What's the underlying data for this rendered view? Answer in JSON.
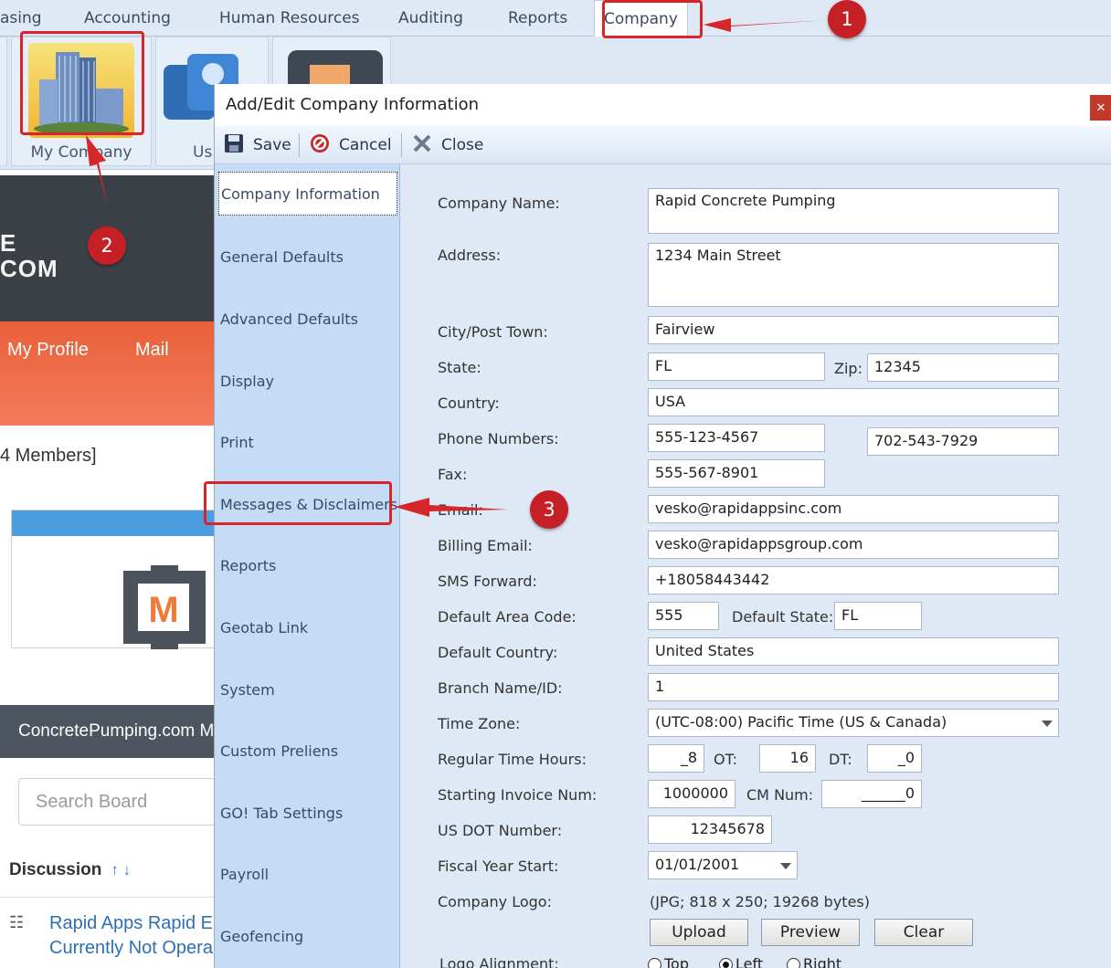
{
  "ribbon": {
    "tabs": [
      "asing",
      "Accounting",
      "Human Resources",
      "Auditing",
      "Reports",
      "Company"
    ],
    "active_tab": "Company",
    "buttons": [
      {
        "label": "My Company"
      },
      {
        "label": "Us"
      }
    ]
  },
  "background": {
    "logo_line1": "E",
    "logo_line2": "COM",
    "nav": [
      "My Profile",
      "Mail"
    ],
    "members": "4 Members]",
    "section_title": "ConcretePumping.com M",
    "search_placeholder": "Search Board",
    "discussion": "Discussion",
    "post_line1": "Rapid Apps Rapid E",
    "post_line2": "Currently Not Opera"
  },
  "dialog": {
    "title": "Add/Edit Company Information",
    "toolbar": {
      "save": "Save",
      "cancel": "Cancel",
      "close": "Close"
    },
    "nav": [
      "Company Information",
      "General Defaults",
      "Advanced Defaults",
      "Display",
      "Print",
      "Messages & Disclaimers",
      "Reports",
      "Geotab Link",
      "System",
      "Custom Preliens",
      "GO! Tab Settings",
      "Payroll",
      "Geofencing"
    ],
    "form": {
      "company_name": {
        "label": "Company Name:",
        "value": "Rapid Concrete Pumping"
      },
      "address": {
        "label": "Address:",
        "value": "1234 Main Street"
      },
      "city": {
        "label": "City/Post Town:",
        "value": "Fairview"
      },
      "state": {
        "label": "State:",
        "value": "FL"
      },
      "zip": {
        "label": "Zip:",
        "value": "12345"
      },
      "country": {
        "label": "Country:",
        "value": "USA"
      },
      "phone": {
        "label": "Phone Numbers:",
        "value1": "555-123-4567",
        "value2": "702-543-7929"
      },
      "fax": {
        "label": "Fax:",
        "value": "555-567-8901"
      },
      "email": {
        "label": "Email:",
        "value": "vesko@rapidappsinc.com"
      },
      "billing_email": {
        "label": "Billing Email:",
        "value": "vesko@rapidappsgroup.com"
      },
      "sms_forward": {
        "label": "SMS Forward:",
        "value": "+18058443442"
      },
      "default_area_code": {
        "label": "Default Area Code:",
        "value": "555"
      },
      "default_state": {
        "label": "Default State:",
        "value": "FL"
      },
      "default_country": {
        "label": "Default Country:",
        "value": "United States"
      },
      "branch": {
        "label": "Branch Name/ID:",
        "value": "1"
      },
      "time_zone": {
        "label": "Time Zone:",
        "value": "(UTC-08:00) Pacific Time (US & Canada)"
      },
      "regular_hours": {
        "label": "Regular Time Hours:",
        "value": "_8"
      },
      "ot": {
        "label": "OT:",
        "value": "16"
      },
      "dt": {
        "label": "DT:",
        "value": "_0"
      },
      "invoice_num": {
        "label": "Starting Invoice Num:",
        "value": "1000000"
      },
      "cm_num": {
        "label": "CM Num:",
        "value": "______0"
      },
      "us_dot": {
        "label": "US DOT Number:",
        "value": "12345678"
      },
      "fiscal_year": {
        "label": "Fiscal Year Start:",
        "value": "01/01/2001"
      },
      "company_logo": {
        "label": "Company Logo:",
        "value": "(JPG; 818 x 250; 19268 bytes)"
      },
      "logo_buttons": {
        "upload": "Upload",
        "preview": "Preview",
        "clear": "Clear"
      },
      "logo_alignment": {
        "label": "Logo Alignment:",
        "options": [
          "Top",
          "Left",
          "Right"
        ],
        "selected": "Left"
      }
    }
  },
  "annotations": {
    "steps": [
      "1",
      "2",
      "3"
    ],
    "color": "#c42026"
  }
}
